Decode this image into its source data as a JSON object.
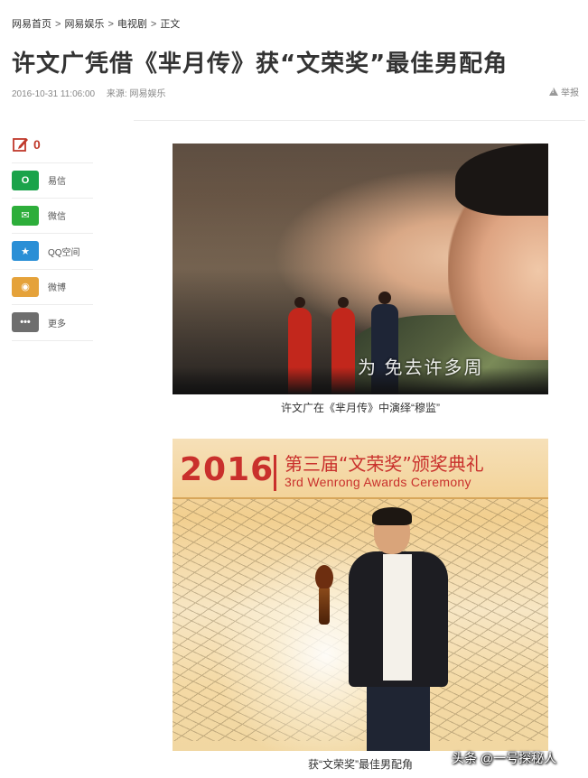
{
  "breadcrumb": {
    "items": [
      "网易首页",
      "网易娱乐",
      "电视剧",
      "正文"
    ],
    "separator": ">"
  },
  "article": {
    "title": "许文广凭借《芈月传》获“文荣奖”最佳男配角",
    "date": "2016-10-31 11:06:00",
    "source": "来源: 网易娱乐",
    "report_label": "举报"
  },
  "comment": {
    "icon": "edit-comment-icon",
    "count": "0",
    "color": "#c0392b"
  },
  "share": {
    "items": [
      {
        "label": "易信",
        "icon": "yixin-icon",
        "color": "#1aa34a",
        "glyph": "O"
      },
      {
        "label": "微信",
        "icon": "wechat-icon",
        "color": "#2dae3a",
        "glyph": "✉"
      },
      {
        "label": "QQ空间",
        "icon": "qzone-icon",
        "color": "#2a8fd6",
        "glyph": "★"
      },
      {
        "label": "微博",
        "icon": "weibo-icon",
        "color": "#e5a23a",
        "glyph": "◉"
      },
      {
        "label": "更多",
        "icon": "more-icon",
        "color": "#6e6e6e",
        "glyph": "•••"
      }
    ]
  },
  "photos": [
    {
      "caption": "许文广在《芈月传》中演绎“穆监”",
      "overlay_text": "为 免去许多周"
    },
    {
      "caption": "获“文荣奖”最佳男配角",
      "banner_year": "2016",
      "banner_cn": "第三届“文荣奖”颁奖典礼",
      "banner_en": "3rd Wenrong Awards Ceremony"
    }
  ],
  "watermark": "头条 @一号探秘人"
}
